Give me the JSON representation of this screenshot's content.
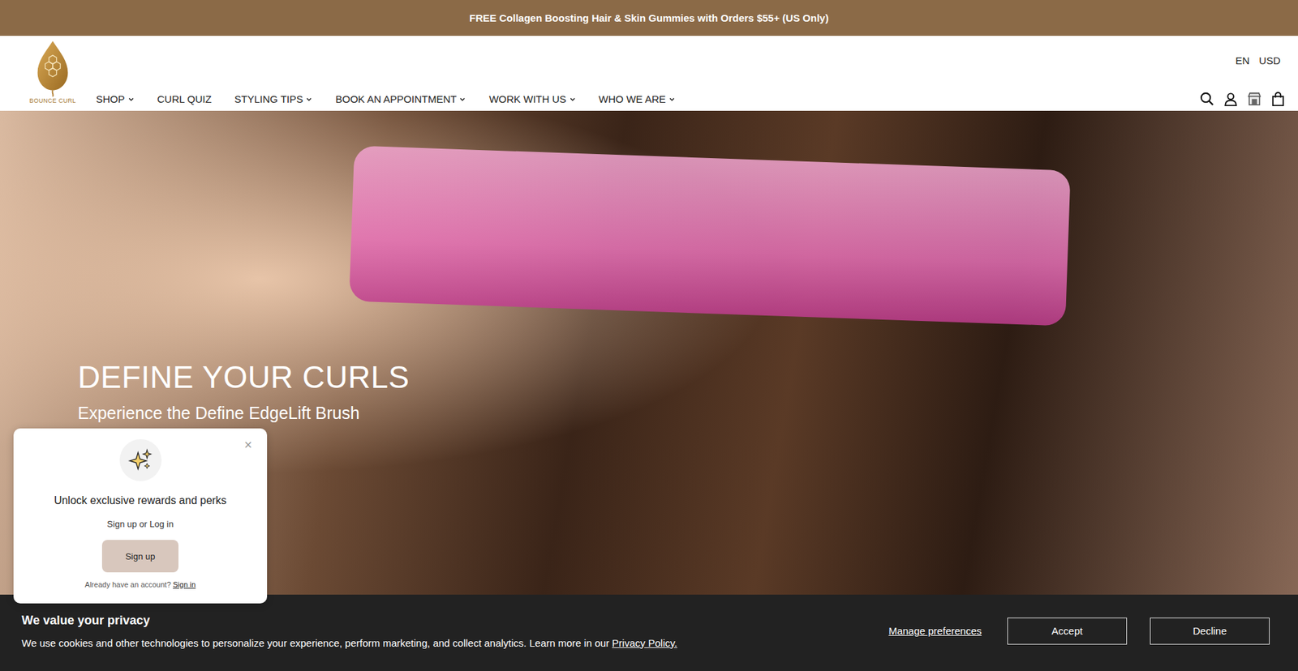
{
  "announcement": "FREE Collagen Boosting Hair & Skin Gummies with Orders $55+ (US Only)",
  "logo": {
    "text": "BOUNCE CURL"
  },
  "locale": {
    "language": "EN",
    "currency": "USD"
  },
  "nav": [
    {
      "label": "SHOP",
      "dropdown": true
    },
    {
      "label": "CURL QUIZ",
      "dropdown": false
    },
    {
      "label": "STYLING TIPS",
      "dropdown": true
    },
    {
      "label": "BOOK AN APPOINTMENT",
      "dropdown": true
    },
    {
      "label": "WORK WITH US",
      "dropdown": true
    },
    {
      "label": "WHO WE ARE",
      "dropdown": true
    }
  ],
  "hero": {
    "title": "DEFINE YOUR CURLS",
    "subtitle": "Experience the Define EdgeLift Brush"
  },
  "rewards_popup": {
    "close": "×",
    "title": "Unlock exclusive rewards and perks",
    "subtitle": "Sign up or Log in",
    "button": "Sign up",
    "footer": "Already have an account?",
    "footer_link": "Sign in"
  },
  "cookie_banner": {
    "title": "We value your privacy",
    "text": "We use cookies and other technologies to personalize your experience, perform marketing, and collect analytics. Learn more in our",
    "link": "Privacy Policy.",
    "manage": "Manage preferences",
    "buttons": [
      "Accept",
      "Decline"
    ]
  }
}
